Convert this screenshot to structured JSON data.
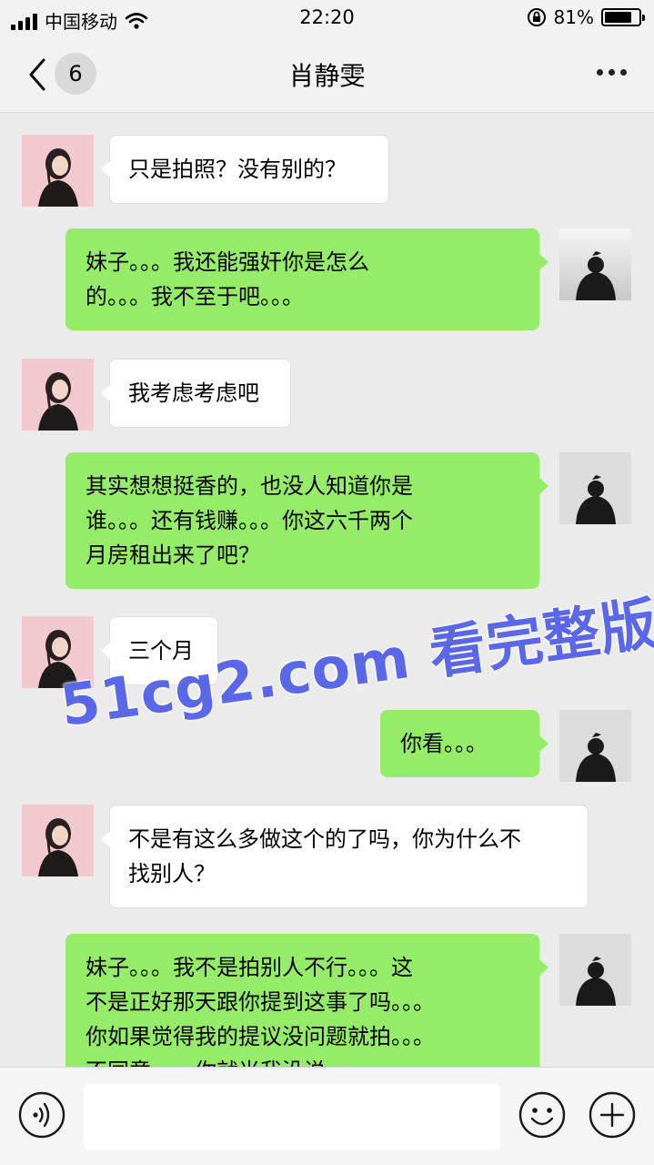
{
  "status_bar": {
    "carrier": "中国移动",
    "time": "22:20",
    "battery": "81%",
    "battery_level": 0.81
  },
  "nav": {
    "unread_count": "6",
    "title": "肖静雯"
  },
  "messages": [
    {
      "side": "left",
      "text": "只是拍照？没有别的？"
    },
    {
      "side": "right",
      "text": "妹子。。。我还能强奸你是怎么\n的。。。我不至于吧。。。"
    },
    {
      "side": "left",
      "text": "我考虑考虑吧"
    },
    {
      "side": "right",
      "text": "其实想想挺香的，也没人知道你是\n谁。。。还有钱赚。。。你这六千两个\n月房租出来了吧？"
    },
    {
      "side": "left",
      "text": "三个月"
    },
    {
      "side": "right",
      "text": "你看。。。"
    },
    {
      "side": "left",
      "text": "不是有这么多做这个的了吗，你为什么不\n找别人？"
    },
    {
      "side": "right",
      "text": "妹子。。。我不是拍别人不行。。。这\n不是正好那天跟你提到这事了吗。。。\n你如果觉得我的提议没问题就拍。。。\n不同意。。。你就当我没说"
    }
  ],
  "watermark": "51cg2.com 看完整版",
  "input_bar": {
    "voice_icon": "voice-icon",
    "emoji_icon": "emoji-icon",
    "plus_icon": "plus-icon"
  },
  "colors": {
    "sent_bubble": "#95ec69",
    "received_bubble": "#ffffff",
    "chat_background": "#ebebeb",
    "watermark": "#5a67e8"
  }
}
